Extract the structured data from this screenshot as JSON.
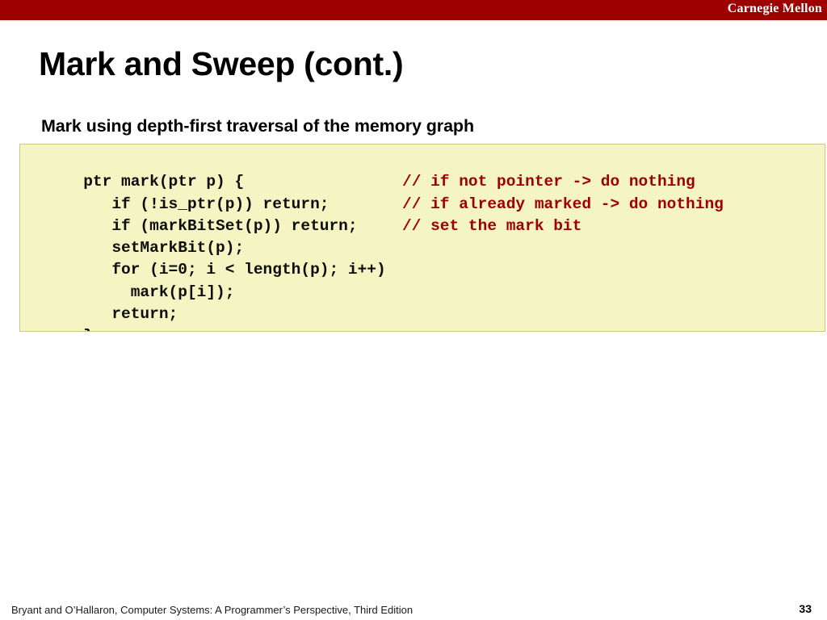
{
  "banner": {
    "institution": "Carnegie Mellon",
    "color": "#9c0000"
  },
  "slide": {
    "title": "Mark and Sweep (cont.)",
    "subtitle": "Mark using depth-first traversal of the memory graph"
  },
  "code_block": {
    "background": "#f5f5c3",
    "border_color": "#c9c98a",
    "code_color": "#0d0d0d",
    "comment_color": "#9c0000",
    "lines": [
      {
        "code": "ptr mark(ptr p) {",
        "comment": ""
      },
      {
        "code": "   if (!is_ptr(p)) return;",
        "comment": "// if not pointer -> do nothing"
      },
      {
        "code": "   if (markBitSet(p)) return;",
        "comment": "// if already marked -> do nothing"
      },
      {
        "code": "   setMarkBit(p);",
        "comment": "// set the mark bit"
      },
      {
        "code": "   for (i=0; i < length(p); i++)",
        "comment": ""
      },
      {
        "code": "     mark(p[i]);",
        "comment": ""
      },
      {
        "code": "   return;",
        "comment": ""
      },
      {
        "code": "}",
        "comment": ""
      }
    ]
  },
  "footer": {
    "attribution": "Bryant and O’Hallaron, Computer Systems: A Programmer’s Perspective, Third Edition",
    "page_number": "33"
  }
}
